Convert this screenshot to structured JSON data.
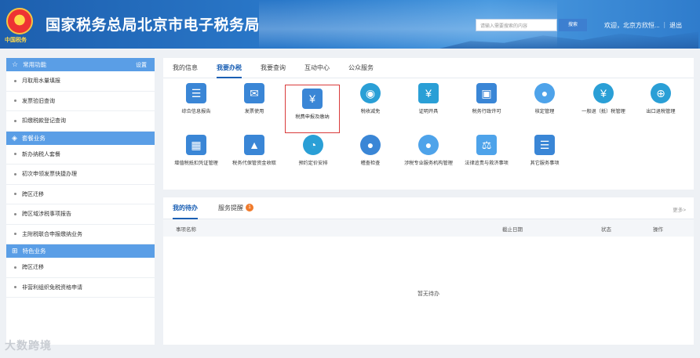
{
  "header": {
    "emblem_text": "中国税务",
    "title": "国家税务总局北京市电子税务局",
    "search_placeholder": "请输入需要搜索的内容",
    "search_button": "搜索",
    "welcome": "欢迎，北京方欣恒... ｜ 退出"
  },
  "sidebar": {
    "sections": [
      {
        "title": "常用功能",
        "icon": "star-icon",
        "setting": "设置",
        "items": [
          "月取用水量填报",
          "发票验旧查询",
          "扣缴税款登记查询"
        ]
      },
      {
        "title": "套餐业务",
        "icon": "layers-icon",
        "items": [
          "新办纳税人套餐",
          "初次申领发票快捷办理",
          "跨区迁移",
          "跨区域涉税事项报告",
          "主附税联合申报缴纳业务"
        ]
      },
      {
        "title": "特色业务",
        "icon": "grid-icon",
        "items": [
          "跨区迁移",
          "非营利组织免税资格申请"
        ]
      }
    ]
  },
  "main": {
    "tabs": [
      "我的信息",
      "我要办税",
      "我要查询",
      "互动中心",
      "公众服务"
    ],
    "active_tab": 1,
    "tiles": [
      {
        "label": "综合信息报告",
        "glyph": "☰"
      },
      {
        "label": "发票使用",
        "glyph": "✉"
      },
      {
        "label": "税费申报及缴纳",
        "glyph": "¥"
      },
      {
        "label": "税收减免",
        "glyph": "◉"
      },
      {
        "label": "证明开具",
        "glyph": "¥"
      },
      {
        "label": "税务行政许可",
        "glyph": "▣"
      },
      {
        "label": "核定管理",
        "glyph": "●"
      },
      {
        "label": "一般退（抵）税管理",
        "glyph": "¥"
      },
      {
        "label": "出口退税管理",
        "glyph": "⊕"
      },
      {
        "label": "增值税抵扣凭证管理",
        "glyph": "▦"
      },
      {
        "label": "税务代保管资金收取",
        "glyph": "▲"
      },
      {
        "label": "预约定价安排",
        "glyph": "◔"
      },
      {
        "label": "稽查检查",
        "glyph": "●"
      },
      {
        "label": "涉税专业服务机构管理",
        "glyph": "●"
      },
      {
        "label": "法律追责与救济事项",
        "glyph": "⚖"
      },
      {
        "label": "其它服务事项",
        "glyph": "☰"
      }
    ]
  },
  "todo": {
    "tabs": [
      "我的待办",
      "服务提醒"
    ],
    "badge": "1",
    "more": "更多>",
    "columns": [
      "事项名称",
      "截止日期",
      "状态",
      "操作"
    ],
    "empty": "暂无待办"
  },
  "watermark": "大数跨境"
}
